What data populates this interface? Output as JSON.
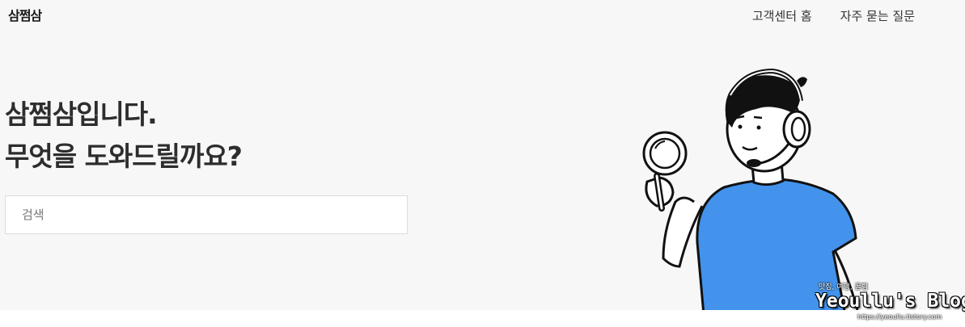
{
  "brand": {
    "logo": "삼쩜삼"
  },
  "nav": {
    "items": [
      "고객센터 홈",
      "자주 묻는 질문"
    ]
  },
  "hero": {
    "line1": "삼쩜삼입니다.",
    "line2": "무엇을 도와드릴까요?"
  },
  "search": {
    "placeholder": "검색",
    "value": ""
  },
  "watermark": {
    "tagline": "맛집, 여행, 꿀팁",
    "title": "Yeoullu's Blog",
    "url": "https://yeoullu.tistory.com"
  },
  "colors": {
    "background": "#f7f7f7",
    "shirt": "#4393ec",
    "text": "#2d2d2d"
  },
  "illustration": {
    "icon": "support-agent-with-magnifier"
  }
}
